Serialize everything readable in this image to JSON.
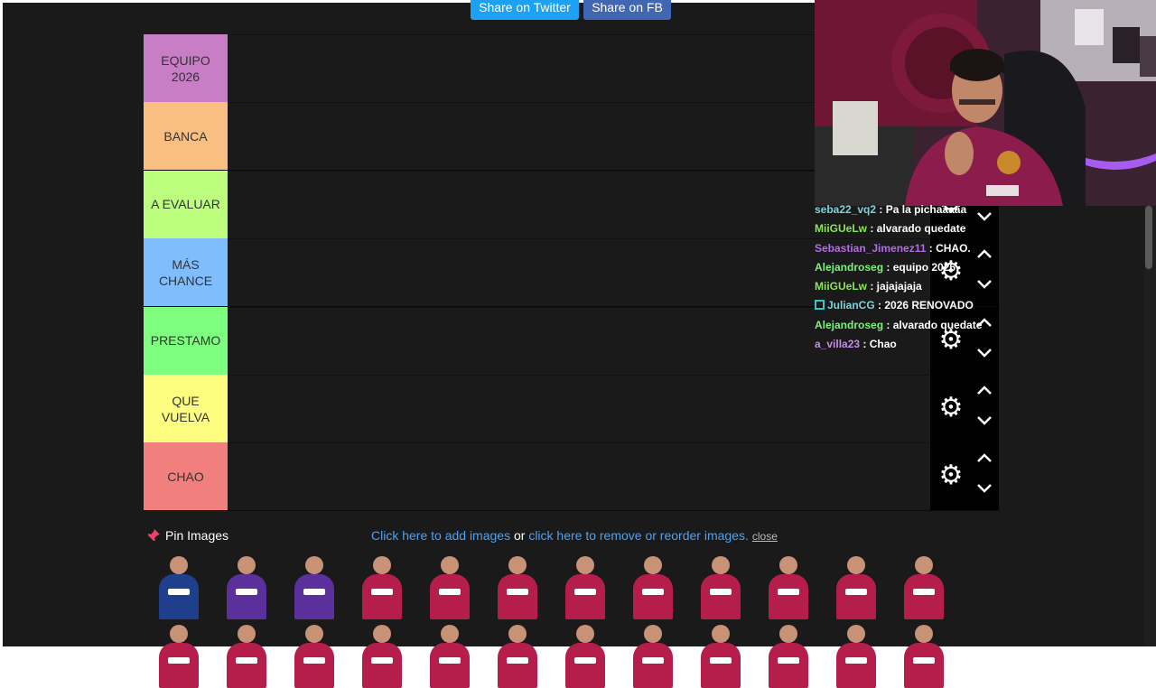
{
  "share": {
    "twitter": "Share on Twitter",
    "facebook": "Share on FB"
  },
  "tiers": [
    {
      "label": "EQUIPO\n2026",
      "color": "#c77ec5"
    },
    {
      "label": "BANCA",
      "color": "#f9be82"
    },
    {
      "label": "A EVALUAR",
      "color": "#bdfd7e"
    },
    {
      "label": "MÁS\nCHANCE",
      "color": "#7fbdfe"
    },
    {
      "label": "PRESTAMO",
      "color": "#7efe7e"
    },
    {
      "label": "QUE\nVUELVA",
      "color": "#fdfd7f"
    },
    {
      "label": "CHAO",
      "color": "#f17f7d"
    }
  ],
  "pin": {
    "label": "Pin Images",
    "add_link": "Click here to add images",
    "or_text": " or ",
    "remove_link": "click here to remove or reorder images.",
    "close": "close"
  },
  "player_kits": [
    "goalkeeper-blue",
    "purple",
    "purple",
    "red",
    "red",
    "red",
    "red",
    "red",
    "red",
    "red",
    "red",
    "red"
  ],
  "chat": [
    {
      "user": "seba22_vq2",
      "user_color": "#7dd3d8",
      "msg": " : Pa la pichaaaaa"
    },
    {
      "user": "MiiGUeLw",
      "user_color": "#8de35b",
      "msg": " : alvarado quedate"
    },
    {
      "user": "Sebastian_Jimenez11",
      "user_color": "#b36be8",
      "msg": " : CHAO."
    },
    {
      "user": "Alejandroseg",
      "user_color": "#7ef07e",
      "msg": " : equipo 2026"
    },
    {
      "user": "MiiGUeLw",
      "user_color": "#8de35b",
      "msg": " : jajajajaja"
    },
    {
      "user": "JulianCG",
      "user_color": "#7dd3d8",
      "msg": " : 2026 RENOVADO",
      "badge": true
    },
    {
      "user": "Alejandroseg",
      "user_color": "#7ef07e",
      "msg": " : alvarado quedate"
    },
    {
      "user": "a_villa23",
      "user_color": "#c38de8",
      "msg": " : Chao"
    }
  ]
}
